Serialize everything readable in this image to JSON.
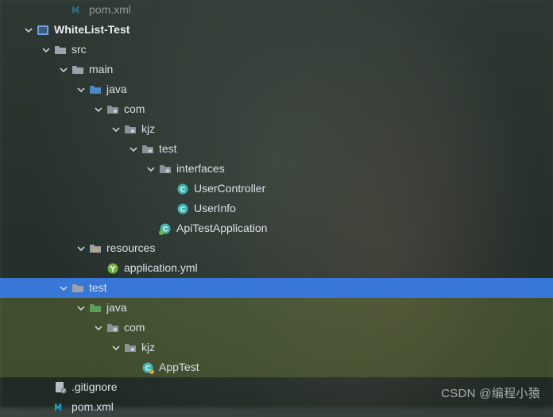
{
  "tree": [
    {
      "id": "pom-top",
      "indent": 3,
      "arrow": "none",
      "icon": "maven",
      "label": "pom.xml",
      "bold": false,
      "row": "dim"
    },
    {
      "id": "whitelist-test",
      "indent": 1,
      "arrow": "down",
      "icon": "module",
      "label": "WhiteList-Test",
      "bold": true,
      "row": ""
    },
    {
      "id": "src",
      "indent": 2,
      "arrow": "down",
      "icon": "folder",
      "label": "src",
      "bold": false,
      "row": ""
    },
    {
      "id": "main",
      "indent": 3,
      "arrow": "down",
      "icon": "folder",
      "label": "main",
      "bold": false,
      "row": ""
    },
    {
      "id": "java-main",
      "indent": 4,
      "arrow": "down",
      "icon": "folder-src",
      "label": "java",
      "bold": false,
      "row": ""
    },
    {
      "id": "com-main",
      "indent": 5,
      "arrow": "down",
      "icon": "package",
      "label": "com",
      "bold": false,
      "row": ""
    },
    {
      "id": "kjz-main",
      "indent": 6,
      "arrow": "down",
      "icon": "package",
      "label": "kjz",
      "bold": false,
      "row": ""
    },
    {
      "id": "test-pkg",
      "indent": 7,
      "arrow": "down",
      "icon": "package",
      "label": "test",
      "bold": false,
      "row": ""
    },
    {
      "id": "interfaces",
      "indent": 8,
      "arrow": "down",
      "icon": "package",
      "label": "interfaces",
      "bold": false,
      "row": ""
    },
    {
      "id": "usercontroller",
      "indent": 9,
      "arrow": "none",
      "icon": "class",
      "label": "UserController",
      "bold": false,
      "row": ""
    },
    {
      "id": "userinfo",
      "indent": 9,
      "arrow": "none",
      "icon": "class",
      "label": "UserInfo",
      "bold": false,
      "row": ""
    },
    {
      "id": "apitestapplication",
      "indent": 8,
      "arrow": "none",
      "icon": "spring-class",
      "label": "ApiTestApplication",
      "bold": false,
      "row": ""
    },
    {
      "id": "resources",
      "indent": 4,
      "arrow": "down",
      "icon": "folder-res",
      "label": "resources",
      "bold": false,
      "row": ""
    },
    {
      "id": "application-yml",
      "indent": 5,
      "arrow": "none",
      "icon": "spring-yml",
      "label": "application.yml",
      "bold": false,
      "row": ""
    },
    {
      "id": "test-folder",
      "indent": 3,
      "arrow": "down",
      "icon": "folder",
      "label": "test",
      "bold": false,
      "row": "selected"
    },
    {
      "id": "java-test",
      "indent": 4,
      "arrow": "down",
      "icon": "folder-test",
      "label": "java",
      "bold": false,
      "row": "highlighted"
    },
    {
      "id": "com-test",
      "indent": 5,
      "arrow": "down",
      "icon": "package",
      "label": "com",
      "bold": false,
      "row": "highlighted"
    },
    {
      "id": "kjz-test",
      "indent": 6,
      "arrow": "down",
      "icon": "package",
      "label": "kjz",
      "bold": false,
      "row": "highlighted"
    },
    {
      "id": "apptest",
      "indent": 7,
      "arrow": "none",
      "icon": "class-test",
      "label": "AppTest",
      "bold": false,
      "row": "highlighted"
    },
    {
      "id": "gitignore",
      "indent": 2,
      "arrow": "none",
      "icon": "gitignore",
      "label": ".gitignore",
      "bold": false,
      "row": ""
    },
    {
      "id": "pom-bottom",
      "indent": 2,
      "arrow": "none",
      "icon": "maven",
      "label": "pom.xml",
      "bold": false,
      "row": ""
    }
  ],
  "watermark": "CSDN @编程小猿",
  "indentBase": 6,
  "indentStep": 22
}
